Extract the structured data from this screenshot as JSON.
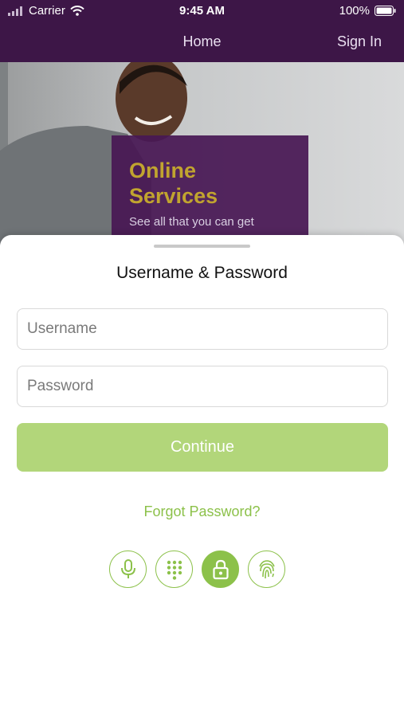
{
  "status_bar": {
    "carrier": "Carrier",
    "time": "9:45 AM",
    "battery": "100%",
    "icons": [
      "signal-icon",
      "wifi-icon",
      "battery-icon"
    ]
  },
  "nav": {
    "title": "Home",
    "sign_in": "Sign In"
  },
  "hero": {
    "heading_line1": "Online",
    "heading_line2": "Services",
    "subtitle": "See all that you can get"
  },
  "login_sheet": {
    "title": "Username & Password",
    "username_placeholder": "Username",
    "password_placeholder": "Password",
    "continue_label": "Continue",
    "forgot_label": "Forgot Password?"
  },
  "auth_methods": [
    {
      "icon": "microphone-icon",
      "selected": false
    },
    {
      "icon": "keypad-icon",
      "selected": false
    },
    {
      "icon": "lock-icon",
      "selected": true
    },
    {
      "icon": "fingerprint-icon",
      "selected": false
    }
  ],
  "colors": {
    "brand_purple": "#3d1647",
    "accent_green": "#8cc14a",
    "button_green": "#b2d67a",
    "hero_gold": "#c1a42f"
  }
}
